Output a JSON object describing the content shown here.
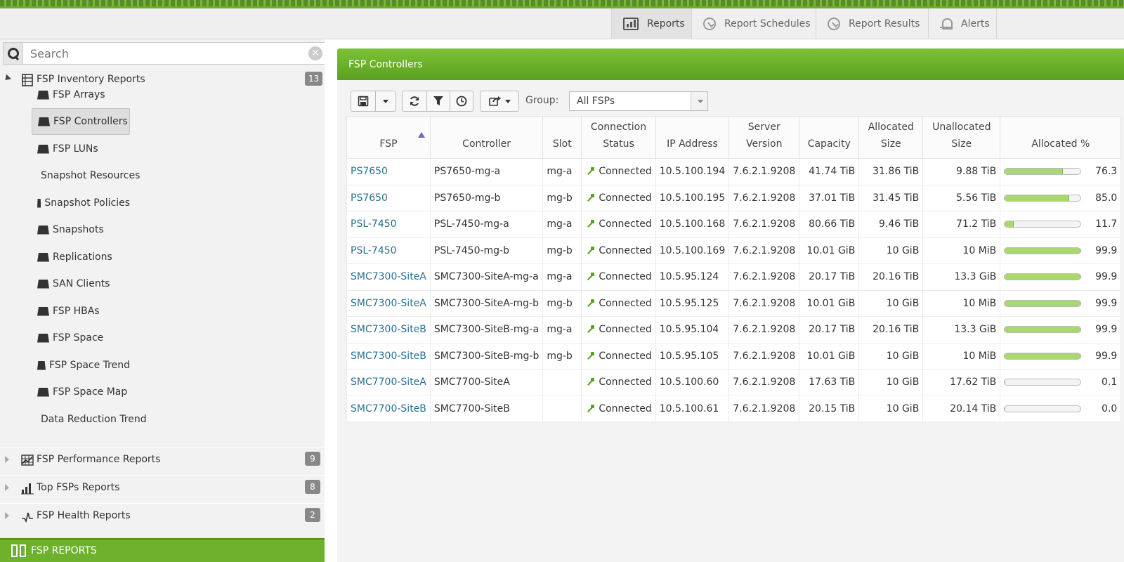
{
  "top_nav": {
    "tabs": [
      {
        "label": "Reports",
        "icon": "bar-chart-icon",
        "active": true
      },
      {
        "label": "Report Schedules",
        "icon": "clock-check-icon",
        "active": false
      },
      {
        "label": "Report Results",
        "icon": "clock-check-icon",
        "active": false
      },
      {
        "label": "Alerts",
        "icon": "bell-icon",
        "active": false
      }
    ]
  },
  "sidebar": {
    "search_placeholder": "Search",
    "groups": [
      {
        "label": "FSP Inventory Reports",
        "count": "13",
        "expanded": true
      },
      {
        "label": "FSP Performance Reports",
        "count": "9",
        "expanded": false
      },
      {
        "label": "Top FSPs Reports",
        "count": "8",
        "expanded": false
      },
      {
        "label": "FSP Health Reports",
        "count": "2",
        "expanded": false
      }
    ],
    "items": [
      "FSP Arrays",
      "FSP Controllers",
      "FSP LUNs",
      "Snapshot Resources",
      "Snapshot Policies",
      "Snapshots",
      "Replications",
      "SAN Clients",
      "FSP HBAs",
      "FSP Space",
      "FSP Space Trend",
      "FSP Space Map",
      "Data Reduction Trend"
    ],
    "selected_item": "FSP Controllers",
    "footer_label": "FSP REPORTS"
  },
  "panel": {
    "title": "FSP Controllers",
    "group_label": "Group:",
    "group_value": "All FSPs"
  },
  "table": {
    "headers": {
      "fsp": "FSP",
      "controller": "Controller",
      "slot": "Slot",
      "conn_1": "Connection",
      "conn_2": "Status",
      "ip": "IP Address",
      "server_1": "Server",
      "server_2": "Version",
      "capacity": "Capacity",
      "alloc_1": "Allocated",
      "alloc_2": "Size",
      "unalloc_1": "Unallocated",
      "unalloc_2": "Size",
      "alloc_pct": "Allocated %"
    },
    "rows": [
      {
        "fsp": "PS7650",
        "controller": "PS7650-mg-a",
        "slot": "mg-a",
        "status": "Connected",
        "ip": "10.5.100.194",
        "version": "7.6.2.1.9208",
        "capacity": "41.74 TiB",
        "allocated": "31.86 TiB",
        "unallocated": "9.88 TiB",
        "pct": 76.3,
        "pct_text": "76.3"
      },
      {
        "fsp": "PS7650",
        "controller": "PS7650-mg-b",
        "slot": "mg-b",
        "status": "Connected",
        "ip": "10.5.100.195",
        "version": "7.6.2.1.9208",
        "capacity": "37.01 TiB",
        "allocated": "31.45 TiB",
        "unallocated": "5.56 TiB",
        "pct": 85.0,
        "pct_text": "85.0"
      },
      {
        "fsp": "PSL-7450",
        "controller": "PSL-7450-mg-a",
        "slot": "mg-a",
        "status": "Connected",
        "ip": "10.5.100.168",
        "version": "7.6.2.1.9208",
        "capacity": "80.66 TiB",
        "allocated": "9.46 TiB",
        "unallocated": "71.2 TiB",
        "pct": 11.7,
        "pct_text": "11.7"
      },
      {
        "fsp": "PSL-7450",
        "controller": "PSL-7450-mg-b",
        "slot": "mg-b",
        "status": "Connected",
        "ip": "10.5.100.169",
        "version": "7.6.2.1.9208",
        "capacity": "10.01 GiB",
        "allocated": "10 GiB",
        "unallocated": "10 MiB",
        "pct": 99.9,
        "pct_text": "99.9"
      },
      {
        "fsp": "SMC7300-SiteA",
        "controller": "SMC7300-SiteA-mg-a",
        "slot": "mg-a",
        "status": "Connected",
        "ip": "10.5.95.124",
        "version": "7.6.2.1.9208",
        "capacity": "20.17 TiB",
        "allocated": "20.16 TiB",
        "unallocated": "13.3 GiB",
        "pct": 99.9,
        "pct_text": "99.9"
      },
      {
        "fsp": "SMC7300-SiteA",
        "controller": "SMC7300-SiteA-mg-b",
        "slot": "mg-b",
        "status": "Connected",
        "ip": "10.5.95.125",
        "version": "7.6.2.1.9208",
        "capacity": "10.01 GiB",
        "allocated": "10 GiB",
        "unallocated": "10 MiB",
        "pct": 99.9,
        "pct_text": "99.9"
      },
      {
        "fsp": "SMC7300-SiteB",
        "controller": "SMC7300-SiteB-mg-a",
        "slot": "mg-a",
        "status": "Connected",
        "ip": "10.5.95.104",
        "version": "7.6.2.1.9208",
        "capacity": "20.17 TiB",
        "allocated": "20.16 TiB",
        "unallocated": "13.3 GiB",
        "pct": 99.9,
        "pct_text": "99.9"
      },
      {
        "fsp": "SMC7300-SiteB",
        "controller": "SMC7300-SiteB-mg-b",
        "slot": "mg-b",
        "status": "Connected",
        "ip": "10.5.95.105",
        "version": "7.6.2.1.9208",
        "capacity": "10.01 GiB",
        "allocated": "10 GiB",
        "unallocated": "10 MiB",
        "pct": 99.9,
        "pct_text": "99.9"
      },
      {
        "fsp": "SMC7700-SiteA",
        "controller": "SMC7700-SiteA",
        "slot": "",
        "status": "Connected",
        "ip": "10.5.100.60",
        "version": "7.6.2.1.9208",
        "capacity": "17.63 TiB",
        "allocated": "10 GiB",
        "unallocated": "17.62 TiB",
        "pct": 0.1,
        "pct_text": "0.1"
      },
      {
        "fsp": "SMC7700-SiteB",
        "controller": "SMC7700-SiteB",
        "slot": "",
        "status": "Connected",
        "ip": "10.5.100.61",
        "version": "7.6.2.1.9208",
        "capacity": "20.15 TiB",
        "allocated": "10 GiB",
        "unallocated": "20.14 TiB",
        "pct": 0.0,
        "pct_text": "0.0"
      }
    ]
  },
  "colors": {
    "accent_green": "#6eb12d",
    "link_blue": "#2a6f8f",
    "bar_fill": "#a8d86e"
  }
}
